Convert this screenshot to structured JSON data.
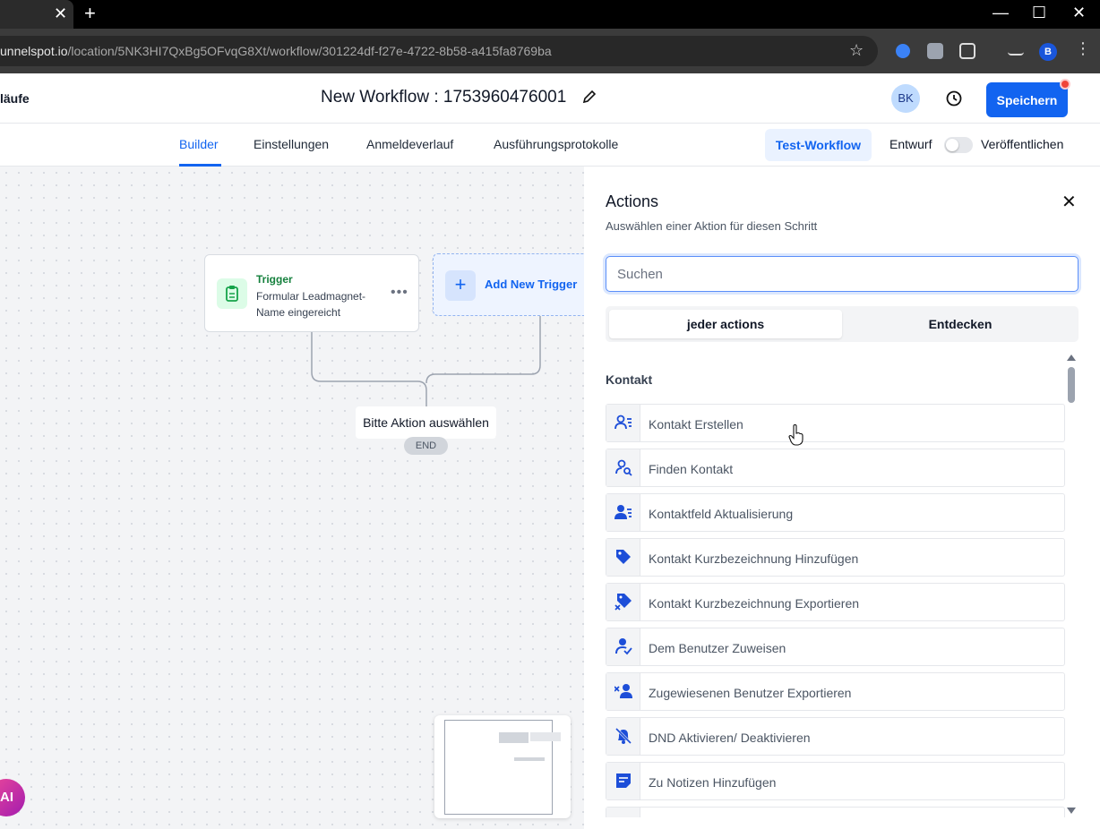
{
  "browser": {
    "tab_close": "✕",
    "new_tab": "+",
    "url_host": "unnelspot.io",
    "url_path": "/location/5NK3HI7QxBg5OFvqG8Xt/workflow/301224df-f27e-4722-8b58-a415fa8769ba",
    "profile_initial": "B"
  },
  "header": {
    "breadcrumb": "läufe",
    "workflow_title": "New Workflow : 1753960476001",
    "user_initials": "BK",
    "save_label": "Speichern"
  },
  "nav": {
    "tabs": [
      {
        "label": "Builder",
        "active": true
      },
      {
        "label": "Einstellungen",
        "active": false
      },
      {
        "label": "Anmeldeverlauf",
        "active": false
      },
      {
        "label": "Ausführungsprotokolle",
        "active": false
      }
    ],
    "test_label": "Test-Workflow",
    "draft_label": "Entwurf",
    "publish_label": "Veröffentlichen",
    "publish_on": false
  },
  "canvas": {
    "trigger": {
      "label": "Trigger",
      "description": "Formular Leadmagnet-Name eingereicht"
    },
    "add_trigger_label": "Add New Trigger",
    "action_placeholder": "Bitte Aktion auswählen",
    "end_label": "END",
    "ai_label": "AI"
  },
  "panel": {
    "title": "Actions",
    "subtitle": "Auswählen einer Aktion für diesen Schritt",
    "search_placeholder": "Suchen",
    "segments": [
      "jeder actions",
      "Entdecken"
    ],
    "section": "Kontakt",
    "items": [
      {
        "label": "Kontakt Erstellen",
        "icon": "user-list-icon"
      },
      {
        "label": "Finden Kontakt",
        "icon": "user-search-icon"
      },
      {
        "label": "Kontaktfeld Aktualisierung",
        "icon": "user-edit-icon"
      },
      {
        "label": "Kontakt Kurzbezeichnung Hinzufügen",
        "icon": "tag-icon"
      },
      {
        "label": "Kontakt Kurzbezeichnung Exportieren",
        "icon": "tag-remove-icon"
      },
      {
        "label": "Dem Benutzer Zuweisen",
        "icon": "user-assign-icon"
      },
      {
        "label": "Zugewiesenen Benutzer Exportieren",
        "icon": "user-remove-icon"
      },
      {
        "label": "DND Aktivieren/ Deaktivieren",
        "icon": "bell-off-icon"
      },
      {
        "label": "Zu Notizen Hinzufügen",
        "icon": "note-icon"
      }
    ]
  },
  "colors": {
    "primary": "#1264f0",
    "trigger_green": "#15803d"
  }
}
